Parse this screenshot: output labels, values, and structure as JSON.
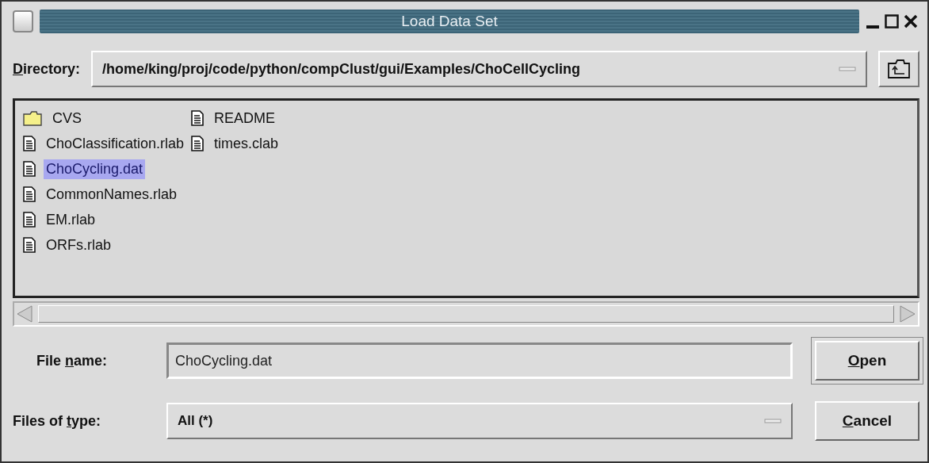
{
  "window": {
    "title": "Load Data Set"
  },
  "directory": {
    "label": {
      "key": "D",
      "post": "irectory:"
    },
    "value": "/home/king/proj/code/python/compClust/gui/Examples/ChoCellCycling"
  },
  "files": [
    {
      "name": "CVS",
      "kind": "folder",
      "selected": false
    },
    {
      "name": "ChoClassification.rlab",
      "kind": "file",
      "selected": false
    },
    {
      "name": "ChoCycling.dat",
      "kind": "file",
      "selected": true
    },
    {
      "name": "CommonNames.rlab",
      "kind": "file",
      "selected": false
    },
    {
      "name": "EM.rlab",
      "kind": "file",
      "selected": false
    },
    {
      "name": "ORFs.rlab",
      "kind": "file",
      "selected": false
    },
    {
      "name": "README",
      "kind": "file",
      "selected": false
    },
    {
      "name": "times.clab",
      "kind": "file",
      "selected": false
    }
  ],
  "file_name": {
    "label": {
      "pre": "File ",
      "key": "n",
      "post": "ame:"
    },
    "value": "ChoCycling.dat"
  },
  "file_type": {
    "label": {
      "pre": "Files of ",
      "key": "t",
      "post": "ype:"
    },
    "value": "All (*)"
  },
  "buttons": [
    {
      "label": {
        "key": "O",
        "post": "pen"
      }
    },
    {
      "label": {
        "key": "C",
        "post": "ancel"
      }
    }
  ]
}
